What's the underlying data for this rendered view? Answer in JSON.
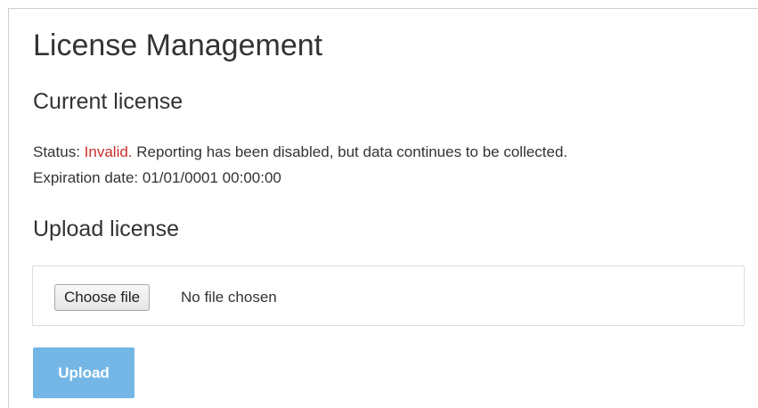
{
  "page": {
    "title": "License Management"
  },
  "current_license": {
    "heading": "Current license",
    "status_label": "Status:",
    "status_value": "Invalid.",
    "status_message": "Reporting has been disabled, but data continues to be collected.",
    "expiration_label": "Expiration date:",
    "expiration_value": "01/01/0001 00:00:00",
    "status_color": "#c9302c"
  },
  "upload_license": {
    "heading": "Upload license",
    "choose_file_label": "Choose file",
    "file_status": "No file chosen",
    "upload_label": "Upload",
    "upload_button_color": "#74b6e6"
  }
}
